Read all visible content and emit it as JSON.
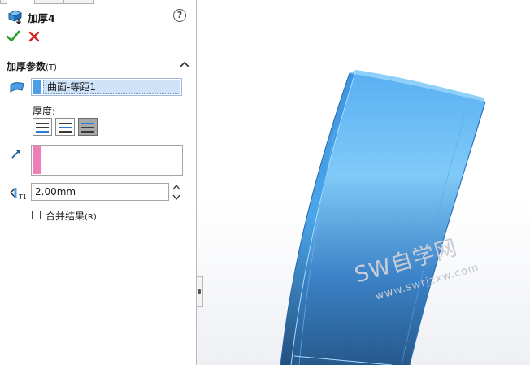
{
  "feature": {
    "title": "加厚4",
    "help_icon": "help-icon",
    "confirm_icon": "checkmark-icon",
    "cancel_icon": "close-icon"
  },
  "parameters": {
    "section_title": "加厚参数",
    "section_shortcut": "(T)",
    "face_to_thicken": "曲面-等距1",
    "thickness_side_label": "厚度:",
    "thickness_side_options": [
      "side-1",
      "both-sides",
      "side-2"
    ],
    "selected_side": "side-2",
    "thickness_value": "2.00mm",
    "merge_result_label": "合并结果",
    "merge_result_shortcut": "(R)",
    "merge_result_checked": false
  },
  "viewport": {
    "watermark_main": "SW自学网",
    "watermark_sub": "www.swrjzxw.com"
  },
  "colors": {
    "face_selection": "#4a9fe8",
    "direction_selection": "#f07cb8",
    "part_top": "#5fb6f5",
    "part_bottom": "#2d5e92"
  }
}
